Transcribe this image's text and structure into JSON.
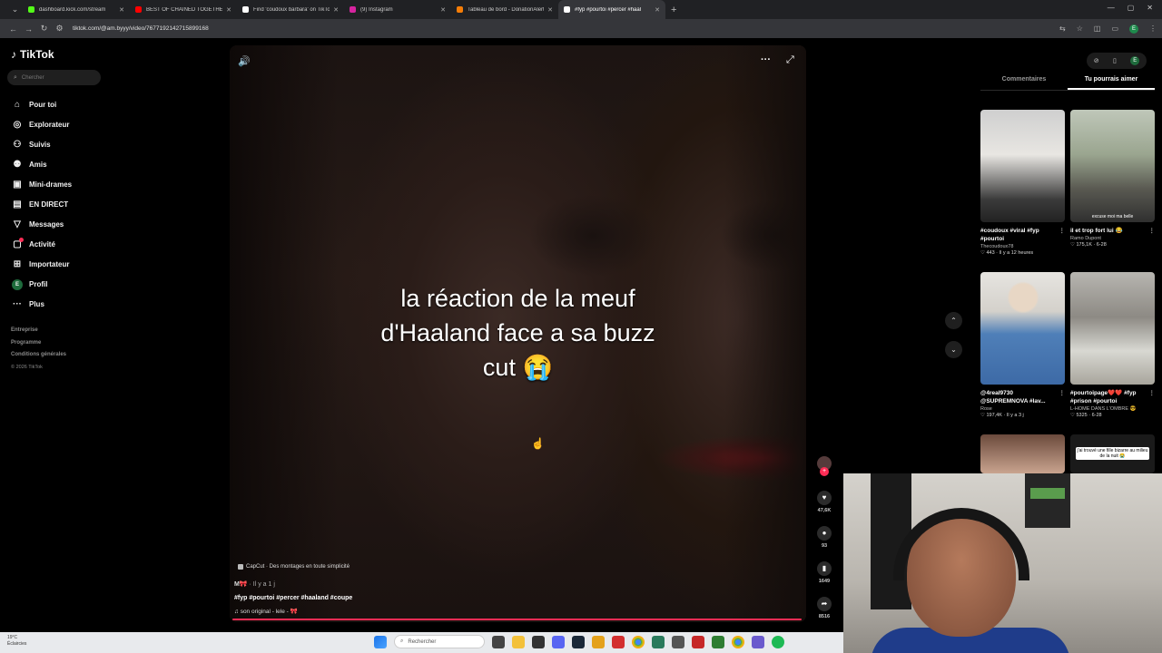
{
  "browser": {
    "tabs": [
      {
        "title": "dashboard.kick.com/stream",
        "color": "#53fc18"
      },
      {
        "title": "BEST OF CHAINED TOGETHER",
        "color": "#ff0000"
      },
      {
        "title": "Find 'coudoux barbara' on TikTok",
        "color": "#ffffff"
      },
      {
        "title": "(9) Instagram",
        "color": "#d6249f"
      },
      {
        "title": "Tableau de bord - DonationAlerts",
        "color": "#f57d07"
      },
      {
        "title": "#fyp #pourtoi #percer #haal",
        "color": "#ffffff"
      }
    ],
    "url": "tiktok.com/@am.byyy/video/7677192142715899168",
    "profile_initial": "E"
  },
  "tiktok": {
    "logo": "TikTok",
    "search_placeholder": "Chercher",
    "nav": [
      {
        "label": "Pour toi",
        "icon": "home-icon",
        "glyph": "⌂"
      },
      {
        "label": "Explorateur",
        "icon": "compass-icon",
        "glyph": "◎"
      },
      {
        "label": "Suivis",
        "icon": "following-icon",
        "glyph": "👤"
      },
      {
        "label": "Amis",
        "icon": "friends-icon",
        "glyph": "👥"
      },
      {
        "label": "Mini-drames",
        "icon": "mini-drama-icon",
        "glyph": "▣"
      },
      {
        "label": "EN DIRECT",
        "icon": "live-icon",
        "glyph": "▤"
      },
      {
        "label": "Messages",
        "icon": "messages-icon",
        "glyph": "▽"
      },
      {
        "label": "Activité",
        "icon": "activity-icon",
        "glyph": "▢"
      },
      {
        "label": "Importateur",
        "icon": "upload-icon",
        "glyph": "⊞"
      },
      {
        "label": "Profil",
        "icon": "profile-icon",
        "glyph": "E"
      },
      {
        "label": "Plus",
        "icon": "more-icon",
        "glyph": "···"
      }
    ],
    "footer": [
      "Entreprise",
      "Programme",
      "Conditions générales"
    ],
    "copyright": "© 2026 TikTok"
  },
  "video": {
    "caption_line1": "la réaction de la meuf",
    "caption_line2": "d'Haaland face a sa buzz",
    "caption_line3": "cut 😭",
    "capcut": "CapCut · Des montages en toute simplicité",
    "author": "M🎀",
    "age": " · Il y a 1 j",
    "hashtags": "#fyp #pourtoi #percer #haaland #coupe",
    "sound": "son original - lele - 🎀",
    "likes": "47,6K",
    "comments": "93",
    "saves": "1649",
    "shares": "8516"
  },
  "panel": {
    "tab_comments": "Commentaires",
    "tab_suggested": "Tu pourrais aimer",
    "cards": [
      {
        "title": "#coudoux #viral #fyp #pourtoi",
        "user": "Thecoudoux78",
        "likes": "443",
        "age": "Il y a 12 heures",
        "overlay": ""
      },
      {
        "title": "il et trop fort lui 😂",
        "user": "Ramo Dupont",
        "likes": "175,1K",
        "age": "6-28",
        "overlay": "excuse moi ma belle"
      },
      {
        "title": "@4real9730 @SUPREMNOVA #lav...",
        "user": "Rose",
        "likes": "197,4K",
        "age": "Il y a 3 j",
        "overlay": ""
      },
      {
        "title": "#pourtoipage❤️❤️ #fyp #prison #pourtoi",
        "user": "L-HOME DANS L'OMBRE 😎",
        "likes": "5325",
        "age": "6-28",
        "overlay": ""
      },
      {
        "title": "",
        "user": "",
        "likes": "",
        "age": "",
        "overlay": ""
      },
      {
        "title": "",
        "user": "",
        "likes": "",
        "age": "",
        "overlay": "j'ai trouvé une fille bizarre au milieu de la nuit 😭"
      }
    ]
  },
  "taskbar": {
    "weather_temp": "19°C",
    "weather_desc": "Éclaircies",
    "search": "Rechercher"
  }
}
